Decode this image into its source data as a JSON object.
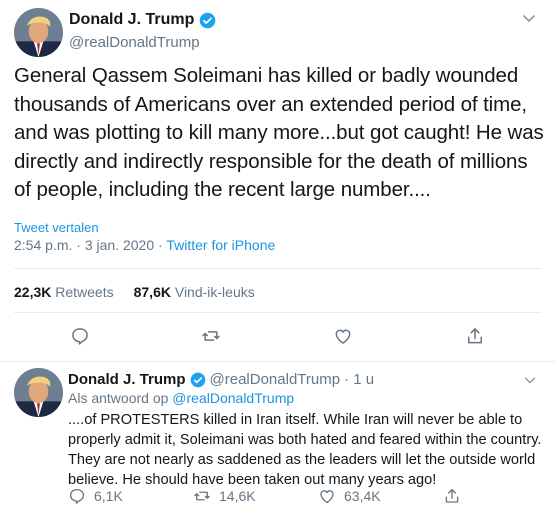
{
  "main_tweet": {
    "display_name": "Donald J. Trump",
    "handle": "@realDonaldTrump",
    "text": "General Qassem Soleimani has killed or badly wounded thousands of Americans over an extended period of time, and was plotting to kill many more...but got caught! He was directly and indirectly responsible for the death of millions of people, including the recent large number....",
    "translate_label": "Tweet vertalen",
    "time": "2:54 p.m.",
    "separator": "·",
    "date": "3 jan. 2020",
    "source": "Twitter for iPhone",
    "retweet_count": "22,3K",
    "retweet_label": "Retweets",
    "like_count": "87,6K",
    "like_label": "Vind-ik-leuks"
  },
  "reply_tweet": {
    "display_name": "Donald J. Trump",
    "handle": "@realDonaldTrump",
    "time_ago": "· 1 u",
    "reply_to_label": "Als antwoord op",
    "reply_to_handle": "@realDonaldTrump",
    "text": "....of PROTESTERS killed in Iran itself. While Iran will never be able to properly admit it, Soleimani was both hated and feared within the country. They are not nearly as saddened as the leaders will let the outside world believe. He should have been taken out many years ago!",
    "reply_count": "6,1K",
    "retweet_count": "14,6K",
    "like_count": "63,4K"
  },
  "icons": {
    "verified": "verified-badge-icon",
    "reply": "reply-icon",
    "retweet": "retweet-icon",
    "like": "heart-icon",
    "share": "share-icon",
    "more": "chevron-down-icon"
  },
  "colors": {
    "accent": "#1b95e0",
    "muted": "#657786",
    "text": "#14171a",
    "divider": "#e6ecf0"
  }
}
